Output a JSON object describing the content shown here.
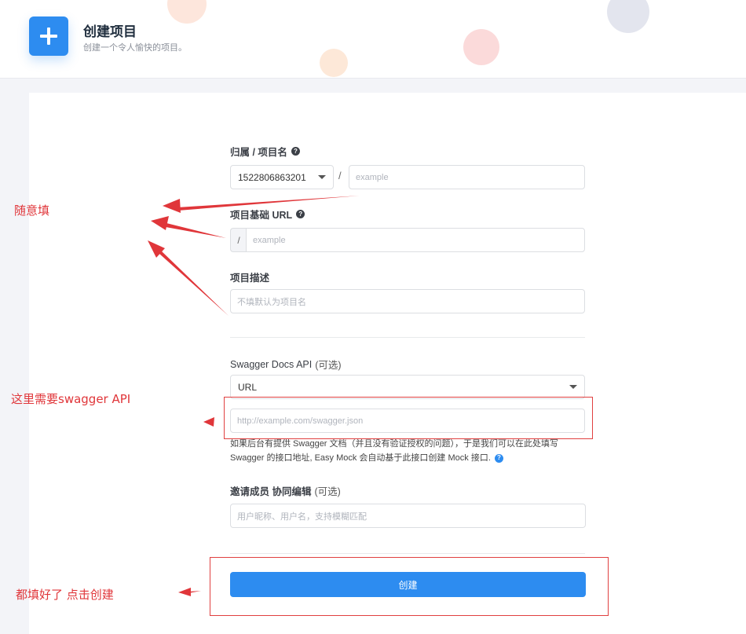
{
  "header": {
    "title": "创建项目",
    "subtitle": "创建一个令人愉快的项目。"
  },
  "form": {
    "owner_label": "归属 / 项目名",
    "owner_value": "1522806863201",
    "name_sep": "/",
    "name_placeholder": "example",
    "base_url_label": "项目基础 URL",
    "base_url_prefix": "/",
    "base_url_placeholder": "example",
    "description_label": "项目描述",
    "description_placeholder": "不填默认为项目名",
    "swagger_label": "Swagger Docs API",
    "swagger_optional": "(可选)",
    "swagger_type_value": "URL",
    "swagger_placeholder": "http://example.com/swagger.json",
    "swagger_help_line1": "如果后台有提供 Swagger 文档（并且没有验证授权的问题），于是我们可以在此处填写",
    "swagger_help_line2": "Swagger 的接口地址, Easy Mock 会自动基于此接口创建 Mock 接口.",
    "invite_label": "邀请成员 协同编辑",
    "invite_optional": "(可选)",
    "invite_placeholder": "用户昵称、用户名，支持模糊匹配",
    "submit_label": "创建"
  },
  "annotations": {
    "fill_freely": "随意填",
    "need_swagger": "这里需要swagger API",
    "all_done": "都填好了  点击创建"
  },
  "colors": {
    "primary": "#2d8cf0",
    "annotation": "#e0363a",
    "page_bg": "#f3f4f8"
  }
}
